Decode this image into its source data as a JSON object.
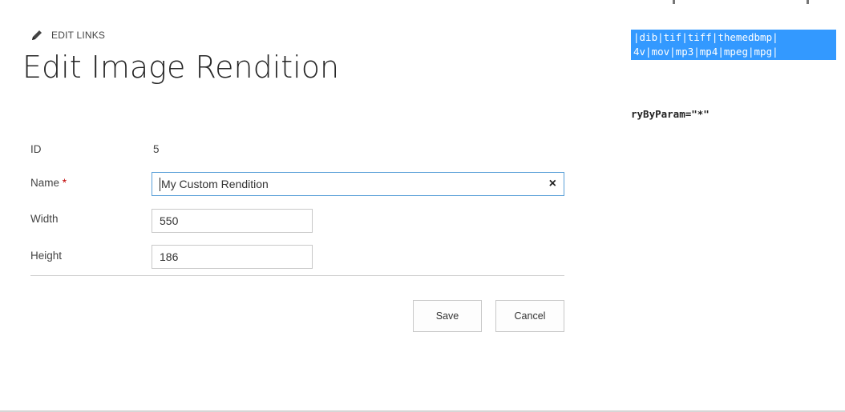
{
  "header": {
    "edit_links_label": "EDIT LINKS",
    "title": "Edit Image Rendition"
  },
  "form": {
    "id": {
      "label": "ID",
      "value": "5"
    },
    "name": {
      "label": "Name",
      "required_marker": "*",
      "value": "My Custom Rendition",
      "clear_icon": "×"
    },
    "width": {
      "label": "Width",
      "value": "550"
    },
    "height": {
      "label": "Height",
      "value": "186"
    }
  },
  "buttons": {
    "save_label": "Save",
    "cancel_label": "Cancel"
  },
  "background_code": {
    "highlighted_lines": [
      "|dib|tif|tiff|themedbmp|",
      "4v|mov|mp3|mp4|mpeg|mpg|"
    ],
    "plain_line": "ryByParam=\"*\""
  },
  "colors": {
    "selection_highlight": "#3399ff",
    "required_marker": "#c00000",
    "focused_border": "#5aa0d8"
  },
  "icons": {
    "edit": "pencil-icon",
    "clear": "clear-x-icon"
  }
}
